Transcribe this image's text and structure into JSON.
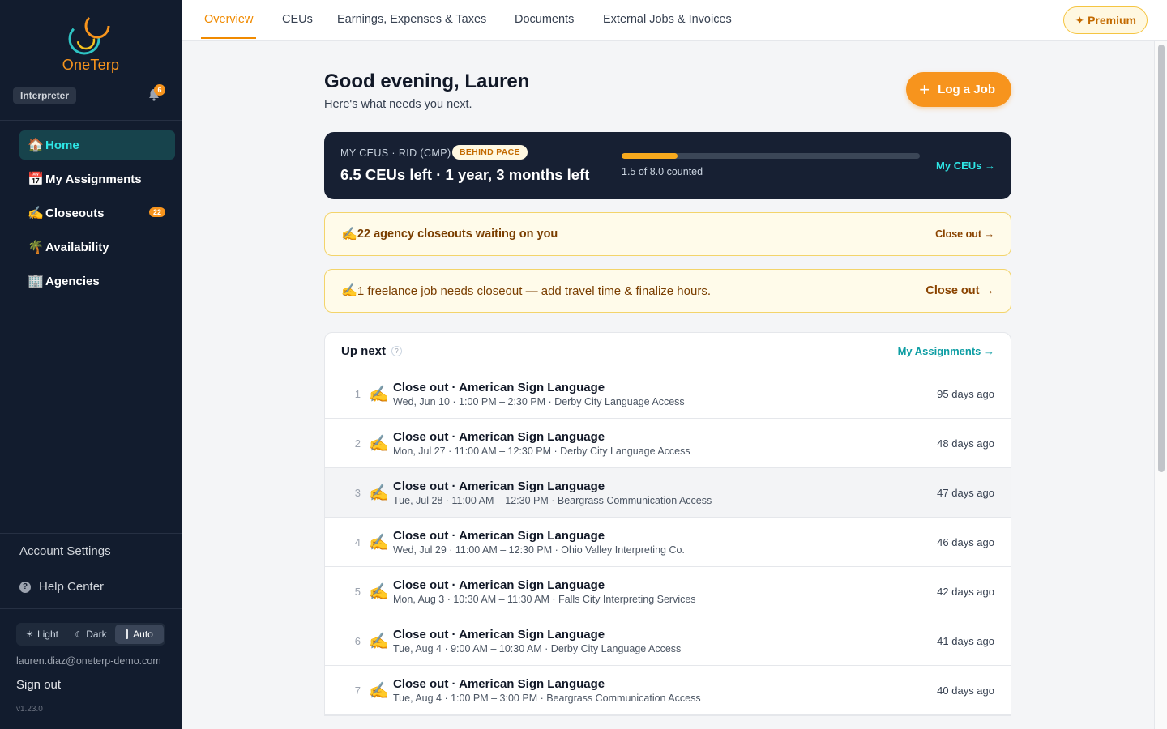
{
  "app": {
    "name": "OneTerp",
    "role": "Interpreter",
    "notification_count": "6"
  },
  "sidebar": {
    "items": [
      {
        "emoji": "🏠",
        "label": "Home",
        "active": true
      },
      {
        "emoji": "📅",
        "label": "My Assignments"
      },
      {
        "emoji": "✍️",
        "label": "Closeouts",
        "badge": "22"
      },
      {
        "emoji": "🌴",
        "label": "Availability"
      },
      {
        "emoji": "🏢",
        "label": "Agencies"
      }
    ],
    "account_settings": "Account Settings",
    "help_center": "Help Center",
    "theme": {
      "light": "Light",
      "dark": "Dark",
      "auto": "Auto",
      "selected": "Auto"
    },
    "email": "lauren.diaz@oneterp-demo.com",
    "sign_out": "Sign out",
    "version": "v1.23.0"
  },
  "topnav": {
    "tabs": [
      "Overview",
      "CEUs",
      "Earnings, Expenses & Taxes",
      "Documents",
      "External Jobs & Invoices"
    ],
    "active": "Overview",
    "premium": "Premium"
  },
  "main": {
    "greeting": "Good evening, Lauren",
    "subtitle": "Here's what needs you next.",
    "log_job": "Log a Job",
    "ceu": {
      "label": "MY CEUS · RID (CMP)",
      "pace": "BEHIND PACE",
      "summary": "6.5 CEUs left · 1 year, 3 months left",
      "counted": 1.5,
      "required": 8.0,
      "progress_text": "1.5 of 8.0 counted",
      "link": "My CEUs →"
    },
    "alerts": [
      {
        "emoji": "✍️",
        "text": "22 agency closeouts waiting on you",
        "link": "Close out →"
      },
      {
        "emoji": "✍️",
        "text": "1 freelance job needs closeout — add travel time & finalize hours.",
        "link": "Close out →"
      }
    ],
    "up_next": {
      "title": "Up next",
      "help": "?",
      "link": "My Assignments →",
      "rows": [
        {
          "num": "1",
          "emoji": "✍️",
          "title": "Close out · American Sign Language",
          "sub": "Wed, Jun 10 · 1:00 PM – 2:30 PM · Derby City Language Access",
          "ago": "95 days ago"
        },
        {
          "num": "2",
          "emoji": "✍️",
          "title": "Close out · American Sign Language",
          "sub": "Mon, Jul 27 · 11:00 AM – 12:30 PM · Derby City Language Access",
          "ago": "48 days ago"
        },
        {
          "num": "3",
          "emoji": "✍️",
          "title": "Close out · American Sign Language",
          "sub": "Tue, Jul 28 · 11:00 AM – 12:30 PM · Beargrass Communication Access",
          "ago": "47 days ago"
        },
        {
          "num": "4",
          "emoji": "✍️",
          "title": "Close out · American Sign Language",
          "sub": "Wed, Jul 29 · 11:00 AM – 12:30 PM · Ohio Valley Interpreting Co.",
          "ago": "46 days ago"
        },
        {
          "num": "5",
          "emoji": "✍️",
          "title": "Close out · American Sign Language",
          "sub": "Mon, Aug 3 · 10:30 AM – 11:30 AM · Falls City Interpreting Services",
          "ago": "42 days ago"
        },
        {
          "num": "6",
          "emoji": "✍️",
          "title": "Close out · American Sign Language",
          "sub": "Tue, Aug 4 · 9:00 AM – 10:30 AM · Derby City Language Access",
          "ago": "41 days ago"
        },
        {
          "num": "7",
          "emoji": "✍️",
          "title": "Close out · American Sign Language",
          "sub": "Tue, Aug 4 · 1:00 PM – 3:00 PM · Beargrass Communication Access",
          "ago": "40 days ago"
        }
      ]
    }
  },
  "colors": {
    "accent": "#f7941d",
    "sidebar": "#121c2e",
    "teal": "#2ee6e6"
  }
}
